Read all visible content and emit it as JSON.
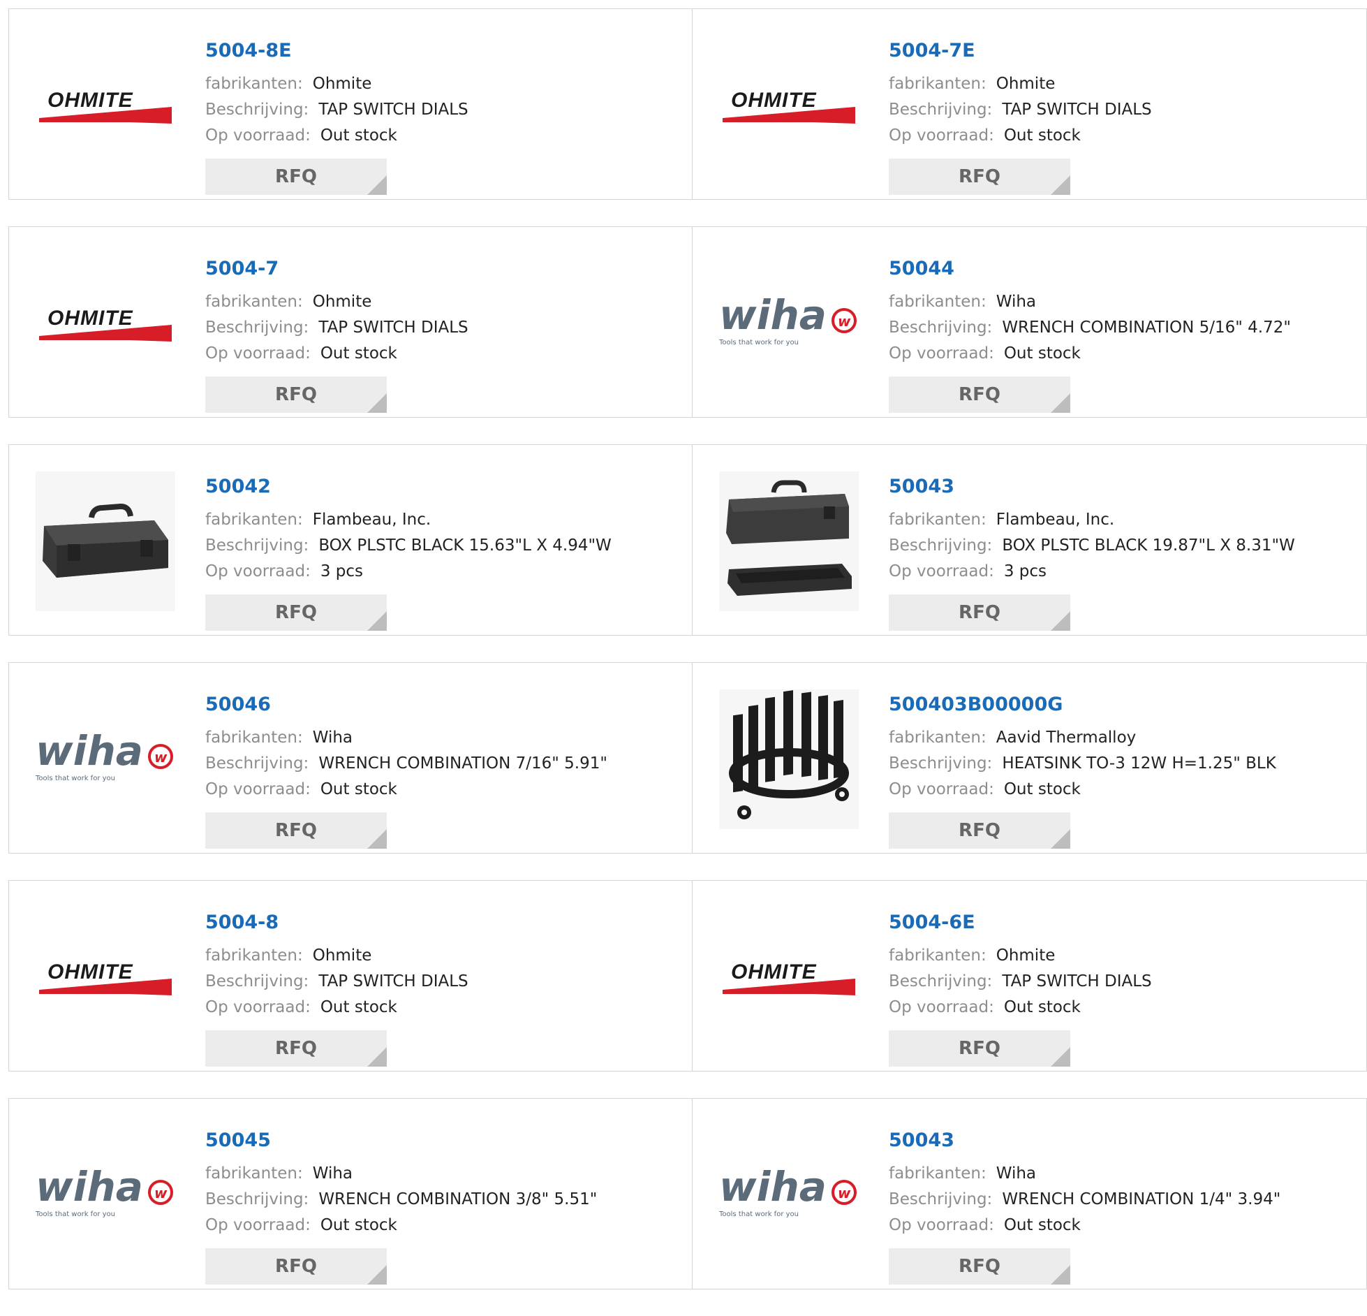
{
  "labels": {
    "manufacturer": "fabrikanten:",
    "description": "Beschrijving:",
    "stock": "Op voorraad:",
    "rfq": "RFQ"
  },
  "logos": {
    "ohmite_text": "OHMITE",
    "wiha_text": "wiha",
    "wiha_tagline": "Tools that work for you"
  },
  "colors": {
    "part_number": "#1a6ab6",
    "ohmite_red": "#d71e28",
    "wiha_grey": "#5b6b7a"
  },
  "products": [
    {
      "pn": "5004-8E",
      "manufacturer": "Ohmite",
      "description": "TAP SWITCH DIALS",
      "stock": "Out stock",
      "image": "ohmite-logo"
    },
    {
      "pn": "5004-7E",
      "manufacturer": "Ohmite",
      "description": "TAP SWITCH DIALS",
      "stock": "Out stock",
      "image": "ohmite-logo"
    },
    {
      "pn": "5004-7",
      "manufacturer": "Ohmite",
      "description": "TAP SWITCH DIALS",
      "stock": "Out stock",
      "image": "ohmite-logo"
    },
    {
      "pn": "50044",
      "manufacturer": "Wiha",
      "description": "WRENCH COMBINATION 5/16\" 4.72\"",
      "stock": "Out stock",
      "image": "wiha-logo"
    },
    {
      "pn": "50042",
      "manufacturer": "Flambeau, Inc.",
      "description": "BOX PLSTC BLACK 15.63\"L X 4.94\"W",
      "stock": "3 pcs",
      "image": "toolbox-photo"
    },
    {
      "pn": "50043",
      "manufacturer": "Flambeau, Inc.",
      "description": "BOX PLSTC BLACK 19.87\"L X 8.31\"W",
      "stock": "3 pcs",
      "image": "toolbox-tray-photo"
    },
    {
      "pn": "50046",
      "manufacturer": "Wiha",
      "description": "WRENCH COMBINATION 7/16\" 5.91\"",
      "stock": "Out stock",
      "image": "wiha-logo"
    },
    {
      "pn": "500403B00000G",
      "manufacturer": "Aavid Thermalloy",
      "description": "HEATSINK TO-3 12W H=1.25\" BLK",
      "stock": "Out stock",
      "image": "heatsink-photo"
    },
    {
      "pn": "5004-8",
      "manufacturer": "Ohmite",
      "description": "TAP SWITCH DIALS",
      "stock": "Out stock",
      "image": "ohmite-logo"
    },
    {
      "pn": "5004-6E",
      "manufacturer": "Ohmite",
      "description": "TAP SWITCH DIALS",
      "stock": "Out stock",
      "image": "ohmite-logo"
    },
    {
      "pn": "50045",
      "manufacturer": "Wiha",
      "description": "WRENCH COMBINATION 3/8\" 5.51\"",
      "stock": "Out stock",
      "image": "wiha-logo"
    },
    {
      "pn": "50043",
      "manufacturer": "Wiha",
      "description": "WRENCH COMBINATION 1/4\" 3.94\"",
      "stock": "Out stock",
      "image": "wiha-logo"
    }
  ]
}
